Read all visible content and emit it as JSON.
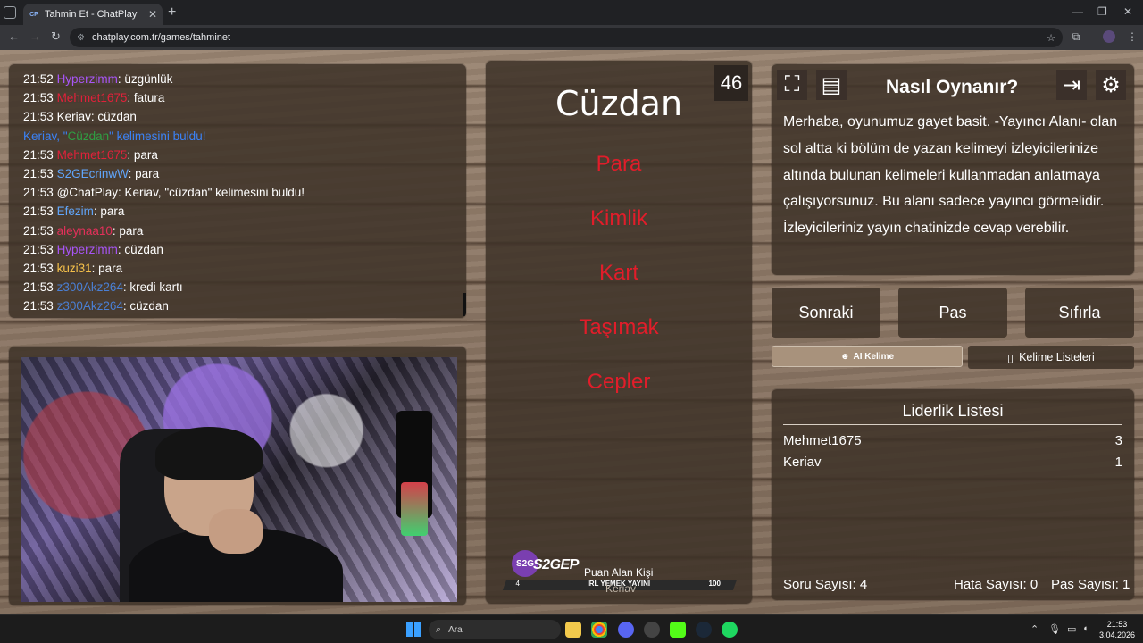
{
  "browser": {
    "tab_title": "Tahmin Et - ChatPlay",
    "tab_favicon": "CP",
    "tab_close": "✕",
    "new_tab": "+",
    "url": "chatplay.com.tr/games/tahminet",
    "controls": {
      "minimize": "—",
      "maximize": "❐",
      "close": "✕"
    }
  },
  "chat": {
    "messages": [
      {
        "time": "21:52",
        "user": "Hyperzimm",
        "user_color": "#a855f7",
        "text": ": üzgünlük"
      },
      {
        "time": "21:53",
        "user": "Mehmet1675",
        "user_color": "#e0213a",
        "text": ": fatura"
      },
      {
        "time": "21:53",
        "user": "Keriav",
        "user_color": "#ffffff",
        "text": ": cüzdan"
      },
      {
        "time": "",
        "user": "",
        "user_color": "#3b82f6",
        "text": ""
      },
      {
        "time": "21:53",
        "user": "Mehmet1675",
        "user_color": "#e0213a",
        "text": ": para"
      },
      {
        "time": "21:53",
        "user": "S2GEcrinwW",
        "user_color": "#60a5fa",
        "text": ": para"
      },
      {
        "time": "21:53",
        "user": "@ChatPlay",
        "user_color": "#ffffff",
        "text": ": Keriav, \"cüzdan\" kelimesini buldu!"
      },
      {
        "time": "21:53",
        "user": "Efezim",
        "user_color": "#60a5fa",
        "text": ": para"
      },
      {
        "time": "21:53",
        "user": "aleynaa10",
        "user_color": "#e3305a",
        "text": ": para"
      },
      {
        "time": "21:53",
        "user": "Hyperzimm",
        "user_color": "#a855f7",
        "text": ": cüzdan"
      },
      {
        "time": "21:53",
        "user": "kuzi31",
        "user_color": "#f5c04a",
        "text": ": para"
      },
      {
        "time": "21:53",
        "user": "z300Akz264",
        "user_color": "#4a7fd4",
        "text": ": kredi kartı"
      },
      {
        "time": "21:53",
        "user": "z300Akz264",
        "user_color": "#4a7fd4",
        "text": ": cüzdan"
      }
    ],
    "found_line": {
      "part1": "Keriav, \"",
      "word": "Cüzdan",
      "part2": "\" kelimesini buldu!"
    }
  },
  "game": {
    "timer": "46",
    "main_word": "Cüzdan",
    "taboo_words": [
      "Para",
      "Kimlik",
      "Kart",
      "Taşımak",
      "Cepler"
    ],
    "score_label": "Puan Alan Kişi",
    "score_name": "Keriav",
    "brand": {
      "logo": "S2G",
      "name": "S2GEP",
      "left": "4",
      "middle": "IRL YEMEK YAYINI",
      "right": "100"
    }
  },
  "how_to": {
    "title": "Nasıl Oynanır?",
    "text": "Merhaba, oyunumuz gayet basit. -Yayıncı Alanı- olan sol altta ki bölüm de yazan kelimeyi izleyicilerinize altında bulunan kelimeleri kullanmadan anlatmaya çalışıyorsunuz. Bu alanı sadece yayıncı görmelidir. İzleyicileriniz yayın chatinizde cevap verebilir."
  },
  "controls": {
    "next": "Sonraki",
    "pass": "Pas",
    "reset": "Sıfırla",
    "ai_word": "AI Kelime",
    "word_lists": "Kelime Listeleri"
  },
  "leaderboard": {
    "title": "Liderlik Listesi",
    "rows": [
      {
        "name": "Mehmet1675",
        "score": "3"
      },
      {
        "name": "Keriav",
        "score": "1"
      }
    ],
    "question_count_label": "Soru Sayısı:",
    "question_count": "4",
    "error_count_label": "Hata Sayısı:",
    "error_count": "0",
    "pass_count_label": "Pas Sayısı:",
    "pass_count": "1"
  },
  "taskbar": {
    "search_placeholder": "Ara",
    "time": "21:53",
    "date": "3.04.2026"
  }
}
